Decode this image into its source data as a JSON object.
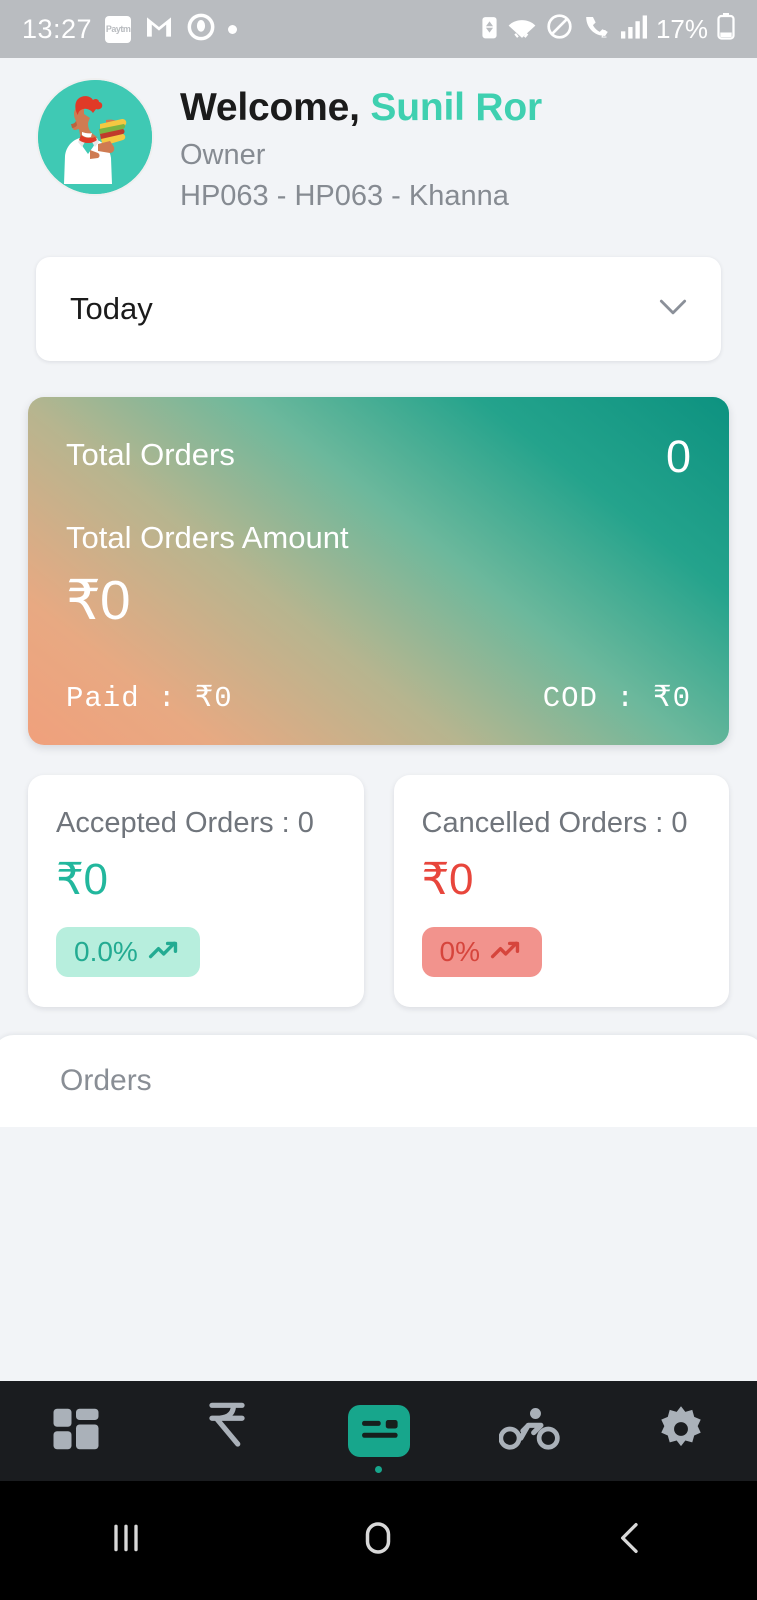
{
  "status_bar": {
    "time": "13:27",
    "left_icons": [
      "paytm-icon",
      "gmail-icon",
      "camera-record-icon",
      "notification-dot-icon"
    ],
    "right_icons": [
      "battery-saver-icon",
      "wifi-icon",
      "do-not-disturb-icon",
      "wifi-calling-icon",
      "signal-bars-icon"
    ],
    "battery_percent": "17%",
    "paytm_label": "Paytm"
  },
  "header": {
    "greeting": "Welcome, ",
    "user_name": "Sunil Ror",
    "role": "Owner",
    "store": "HP063 - HP063 - Khanna",
    "avatar_name": "user-avatar-burger-man"
  },
  "period_filter": {
    "selected": "Today",
    "chevron": "chevron-down-icon"
  },
  "totals_card": {
    "orders_label": "Total Orders",
    "orders_count": "0",
    "amount_label": "Total Orders Amount",
    "amount_value": "₹0",
    "paid_text": "Paid  :  ₹0",
    "cod_text": "COD  :  ₹0"
  },
  "stat_cards": [
    {
      "title": "Accepted Orders : 0",
      "amount": "₹0",
      "badge": "0.0%",
      "tone": "teal"
    },
    {
      "title": "Cancelled Orders : 0",
      "amount": "₹0",
      "badge": "0%",
      "tone": "red"
    }
  ],
  "orders_section": {
    "title": "Orders"
  },
  "bottom_nav": [
    {
      "name": "dashboard",
      "icon": "dashboard-grid-icon",
      "active": false
    },
    {
      "name": "payments",
      "icon": "rupee-icon",
      "active": false
    },
    {
      "name": "orders",
      "icon": "orders-card-icon",
      "active": true
    },
    {
      "name": "delivery",
      "icon": "cyclist-delivery-icon",
      "active": false
    },
    {
      "name": "settings",
      "icon": "gear-icon",
      "active": false
    }
  ],
  "system_nav": [
    {
      "name": "recents",
      "icon": "recents-icon"
    },
    {
      "name": "home",
      "icon": "home-icon"
    },
    {
      "name": "back",
      "icon": "back-chevron-icon"
    }
  ],
  "colors": {
    "accent_teal": "#3fd0b0",
    "card_gradient_start": "#f0a07c",
    "card_gradient_end": "#0d9280",
    "amount_teal": "#22b79d",
    "amount_red": "#e8463c",
    "badge_teal_bg": "#b7eedd",
    "badge_red_bg": "#f2938d",
    "page_bg": "#f2f4f7",
    "nav_bg": "#1a1c1f"
  }
}
